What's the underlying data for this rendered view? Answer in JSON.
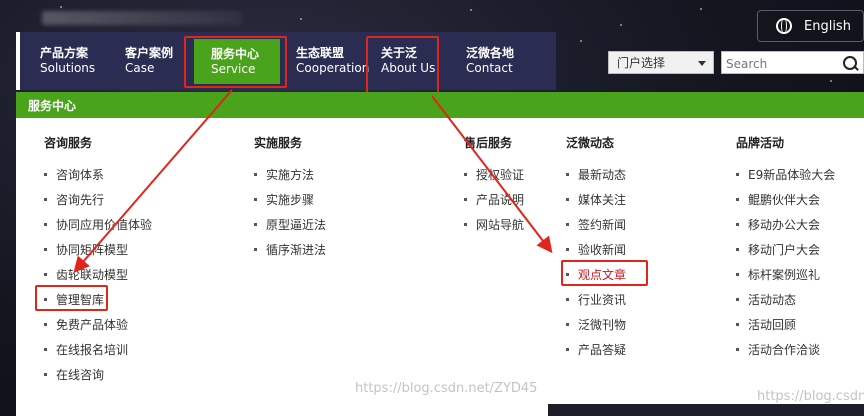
{
  "top": {
    "language_label": "English"
  },
  "nav": {
    "items": [
      {
        "zh": "产品方案",
        "en": "Solutions"
      },
      {
        "zh": "客户案例",
        "en": "Case"
      },
      {
        "zh": "服务中心",
        "en": "Service"
      },
      {
        "zh": "生态联盟",
        "en": "Cooperation"
      },
      {
        "zh": "关于泛",
        "en": "About Us"
      },
      {
        "zh": "泛微各地",
        "en": "Contact"
      }
    ]
  },
  "portal_select": {
    "label": "门户选择"
  },
  "search": {
    "placeholder": "Search"
  },
  "panel": {
    "title": "服务中心",
    "columns": [
      {
        "title": "咨询服务",
        "items": [
          "咨询体系",
          "咨询先行",
          "协同应用价值体验",
          "协同矩阵模型",
          "齿轮联动模型",
          "管理智库",
          "免费产品体验",
          "在线报名培训",
          "在线咨询"
        ]
      },
      {
        "title": "实施服务",
        "items": [
          "实施方法",
          "实施步骤",
          "原型逼近法",
          "循序渐进法"
        ]
      },
      {
        "title": "售后服务",
        "items": [
          "授权验证",
          "产品说明",
          "网站导航"
        ]
      },
      {
        "title": "泛微动态",
        "items": [
          "最新动态",
          "媒体关注",
          "签约新闻",
          "验收新闻",
          "观点文章",
          "行业资讯",
          "泛微刊物",
          "产品答疑"
        ]
      },
      {
        "title": "品牌活动",
        "items": [
          "E9新品体验大会",
          "鲲鹏伙伴大会",
          "移动办公大会",
          "移动门户大会",
          "标杆案例巡礼",
          "活动动态",
          "活动回顾",
          "活动合作洽谈"
        ]
      }
    ]
  },
  "watermarks": {
    "main": "https://blog.csdn.net/ZYD45",
    "corner": "https://blog.csdn"
  },
  "colors": {
    "accent_green": "#4aa41b",
    "nav_bg": "#2b2c52",
    "highlight_red": "#e0251b",
    "link_red": "#c9181f"
  }
}
